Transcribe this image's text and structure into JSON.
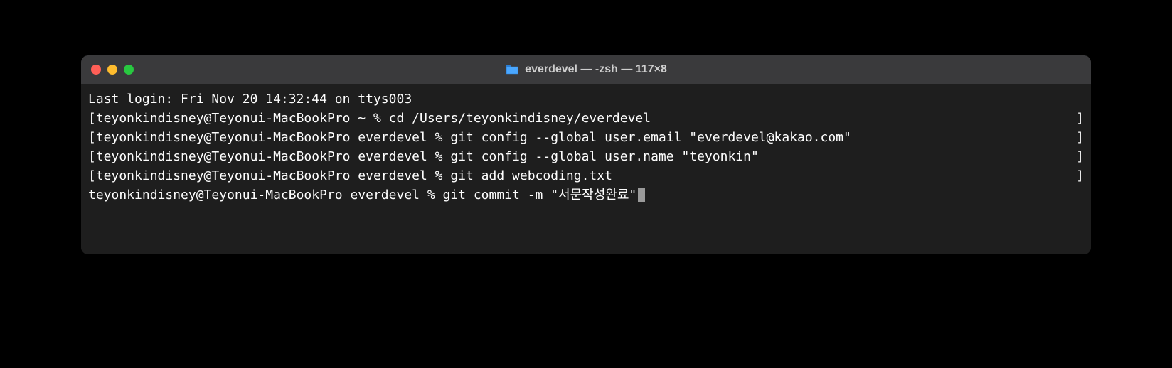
{
  "titlebar": {
    "title": "everdevel — -zsh — 117×8"
  },
  "terminal": {
    "last_login": "Last login: Fri Nov 20 14:32:44 on ttys003",
    "lines": [
      {
        "left": "[teyonkindisney@Teyonui-MacBookPro ~ % cd /Users/teyonkindisney/everdevel",
        "right": "]"
      },
      {
        "left": "[teyonkindisney@Teyonui-MacBookPro everdevel % git config --global user.email \"everdevel@kakao.com\"",
        "right": "]"
      },
      {
        "left": "[teyonkindisney@Teyonui-MacBookPro everdevel % git config --global user.name \"teyonkin\"",
        "right": "]"
      },
      {
        "left": "[teyonkindisney@Teyonui-MacBookPro everdevel % git add webcoding.txt",
        "right": "]"
      }
    ],
    "current": {
      "prompt": "teyonkindisney@Teyonui-MacBookPro everdevel % ",
      "command": "git commit -m \"서문작성완료\""
    }
  }
}
